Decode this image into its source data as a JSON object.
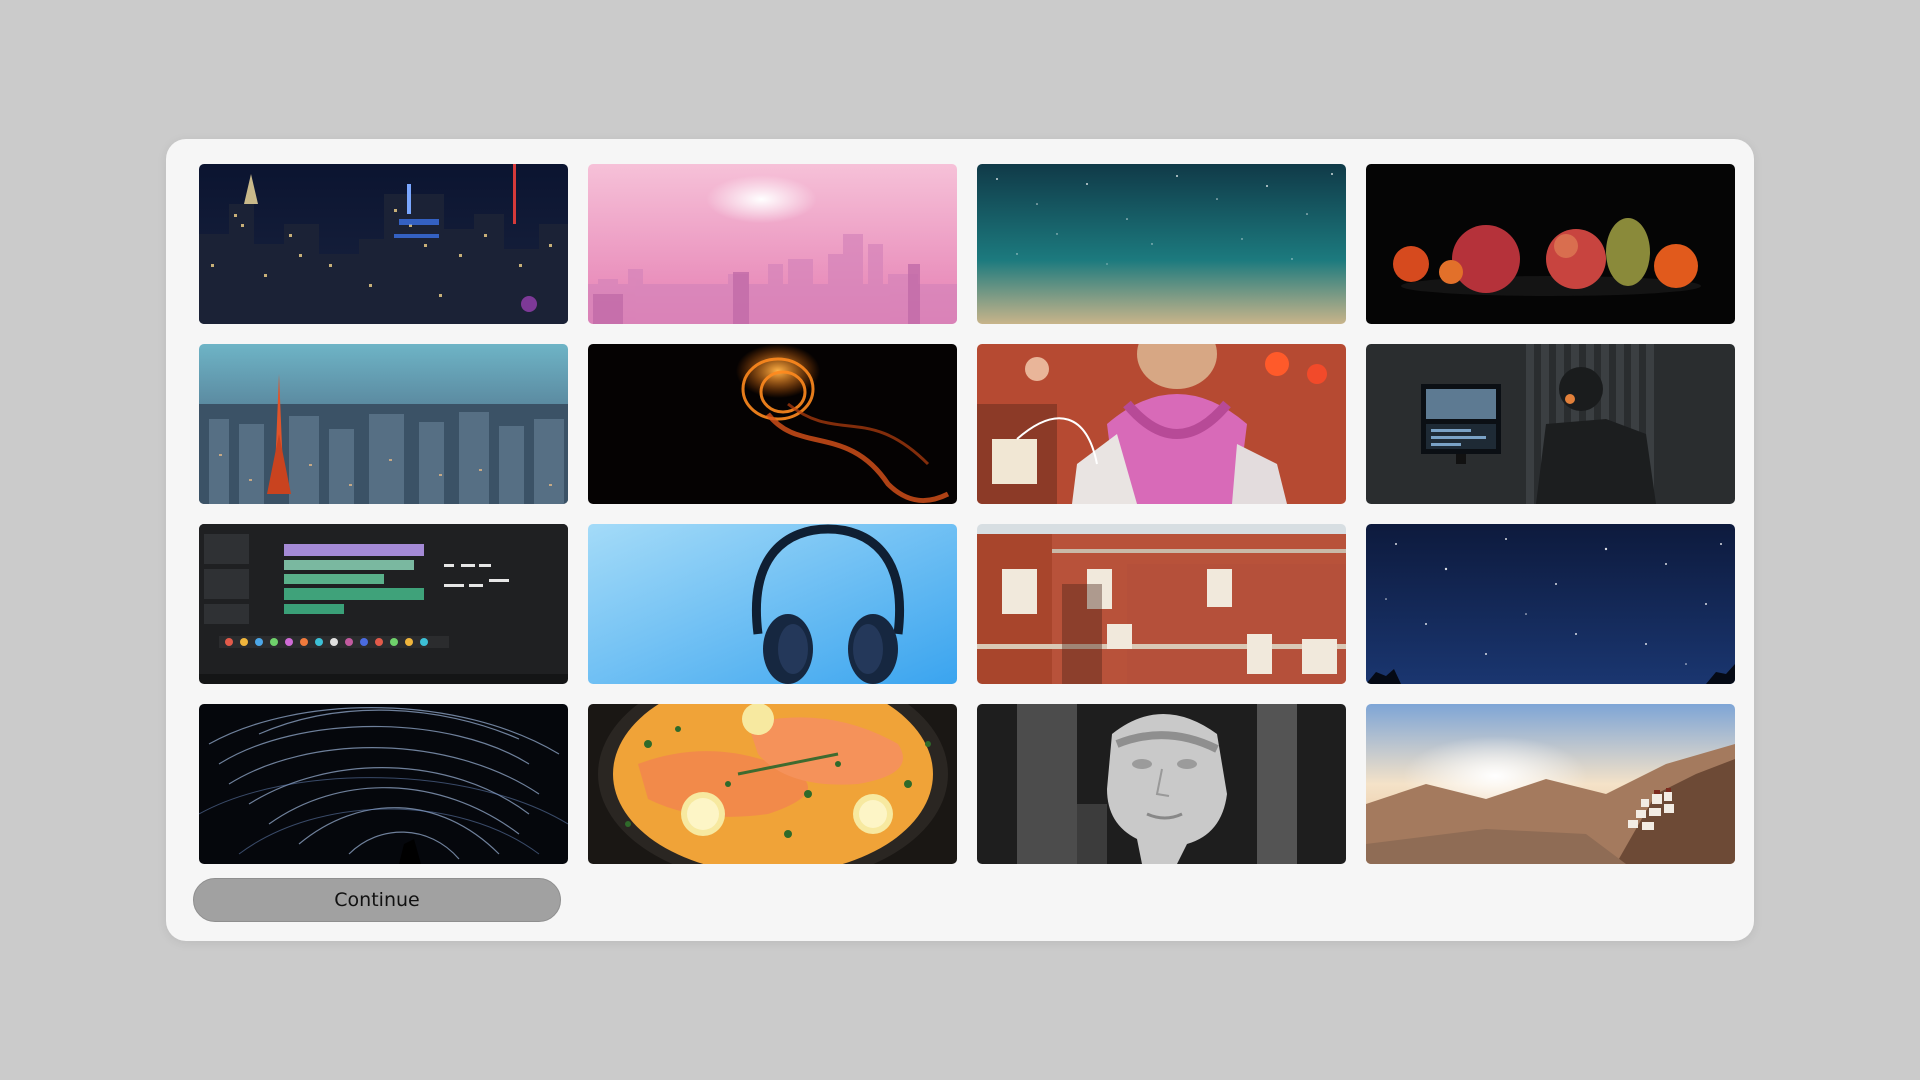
{
  "dialog": {
    "continue_label": "Continue"
  },
  "tiles": [
    {
      "name": "tile-nyc-night-skyline"
    },
    {
      "name": "tile-pink-haze-city"
    },
    {
      "name": "tile-teal-starry-sky"
    },
    {
      "name": "tile-fruit-bowl-dark"
    },
    {
      "name": "tile-tokyo-tower-city"
    },
    {
      "name": "tile-orange-light-swirl"
    },
    {
      "name": "tile-child-pink-scarf"
    },
    {
      "name": "tile-person-editing-video"
    },
    {
      "name": "tile-video-editor-screen"
    },
    {
      "name": "tile-headphones-blue"
    },
    {
      "name": "tile-red-brick-building"
    },
    {
      "name": "tile-night-sky-stars"
    },
    {
      "name": "tile-star-trails-swirl"
    },
    {
      "name": "tile-salmon-curry"
    },
    {
      "name": "tile-greek-statue-bw"
    },
    {
      "name": "tile-mountain-monastery"
    }
  ],
  "colors": {
    "background": "#cbcbcb",
    "panel": "#f6f6f6",
    "button": "#a1a1a1"
  }
}
